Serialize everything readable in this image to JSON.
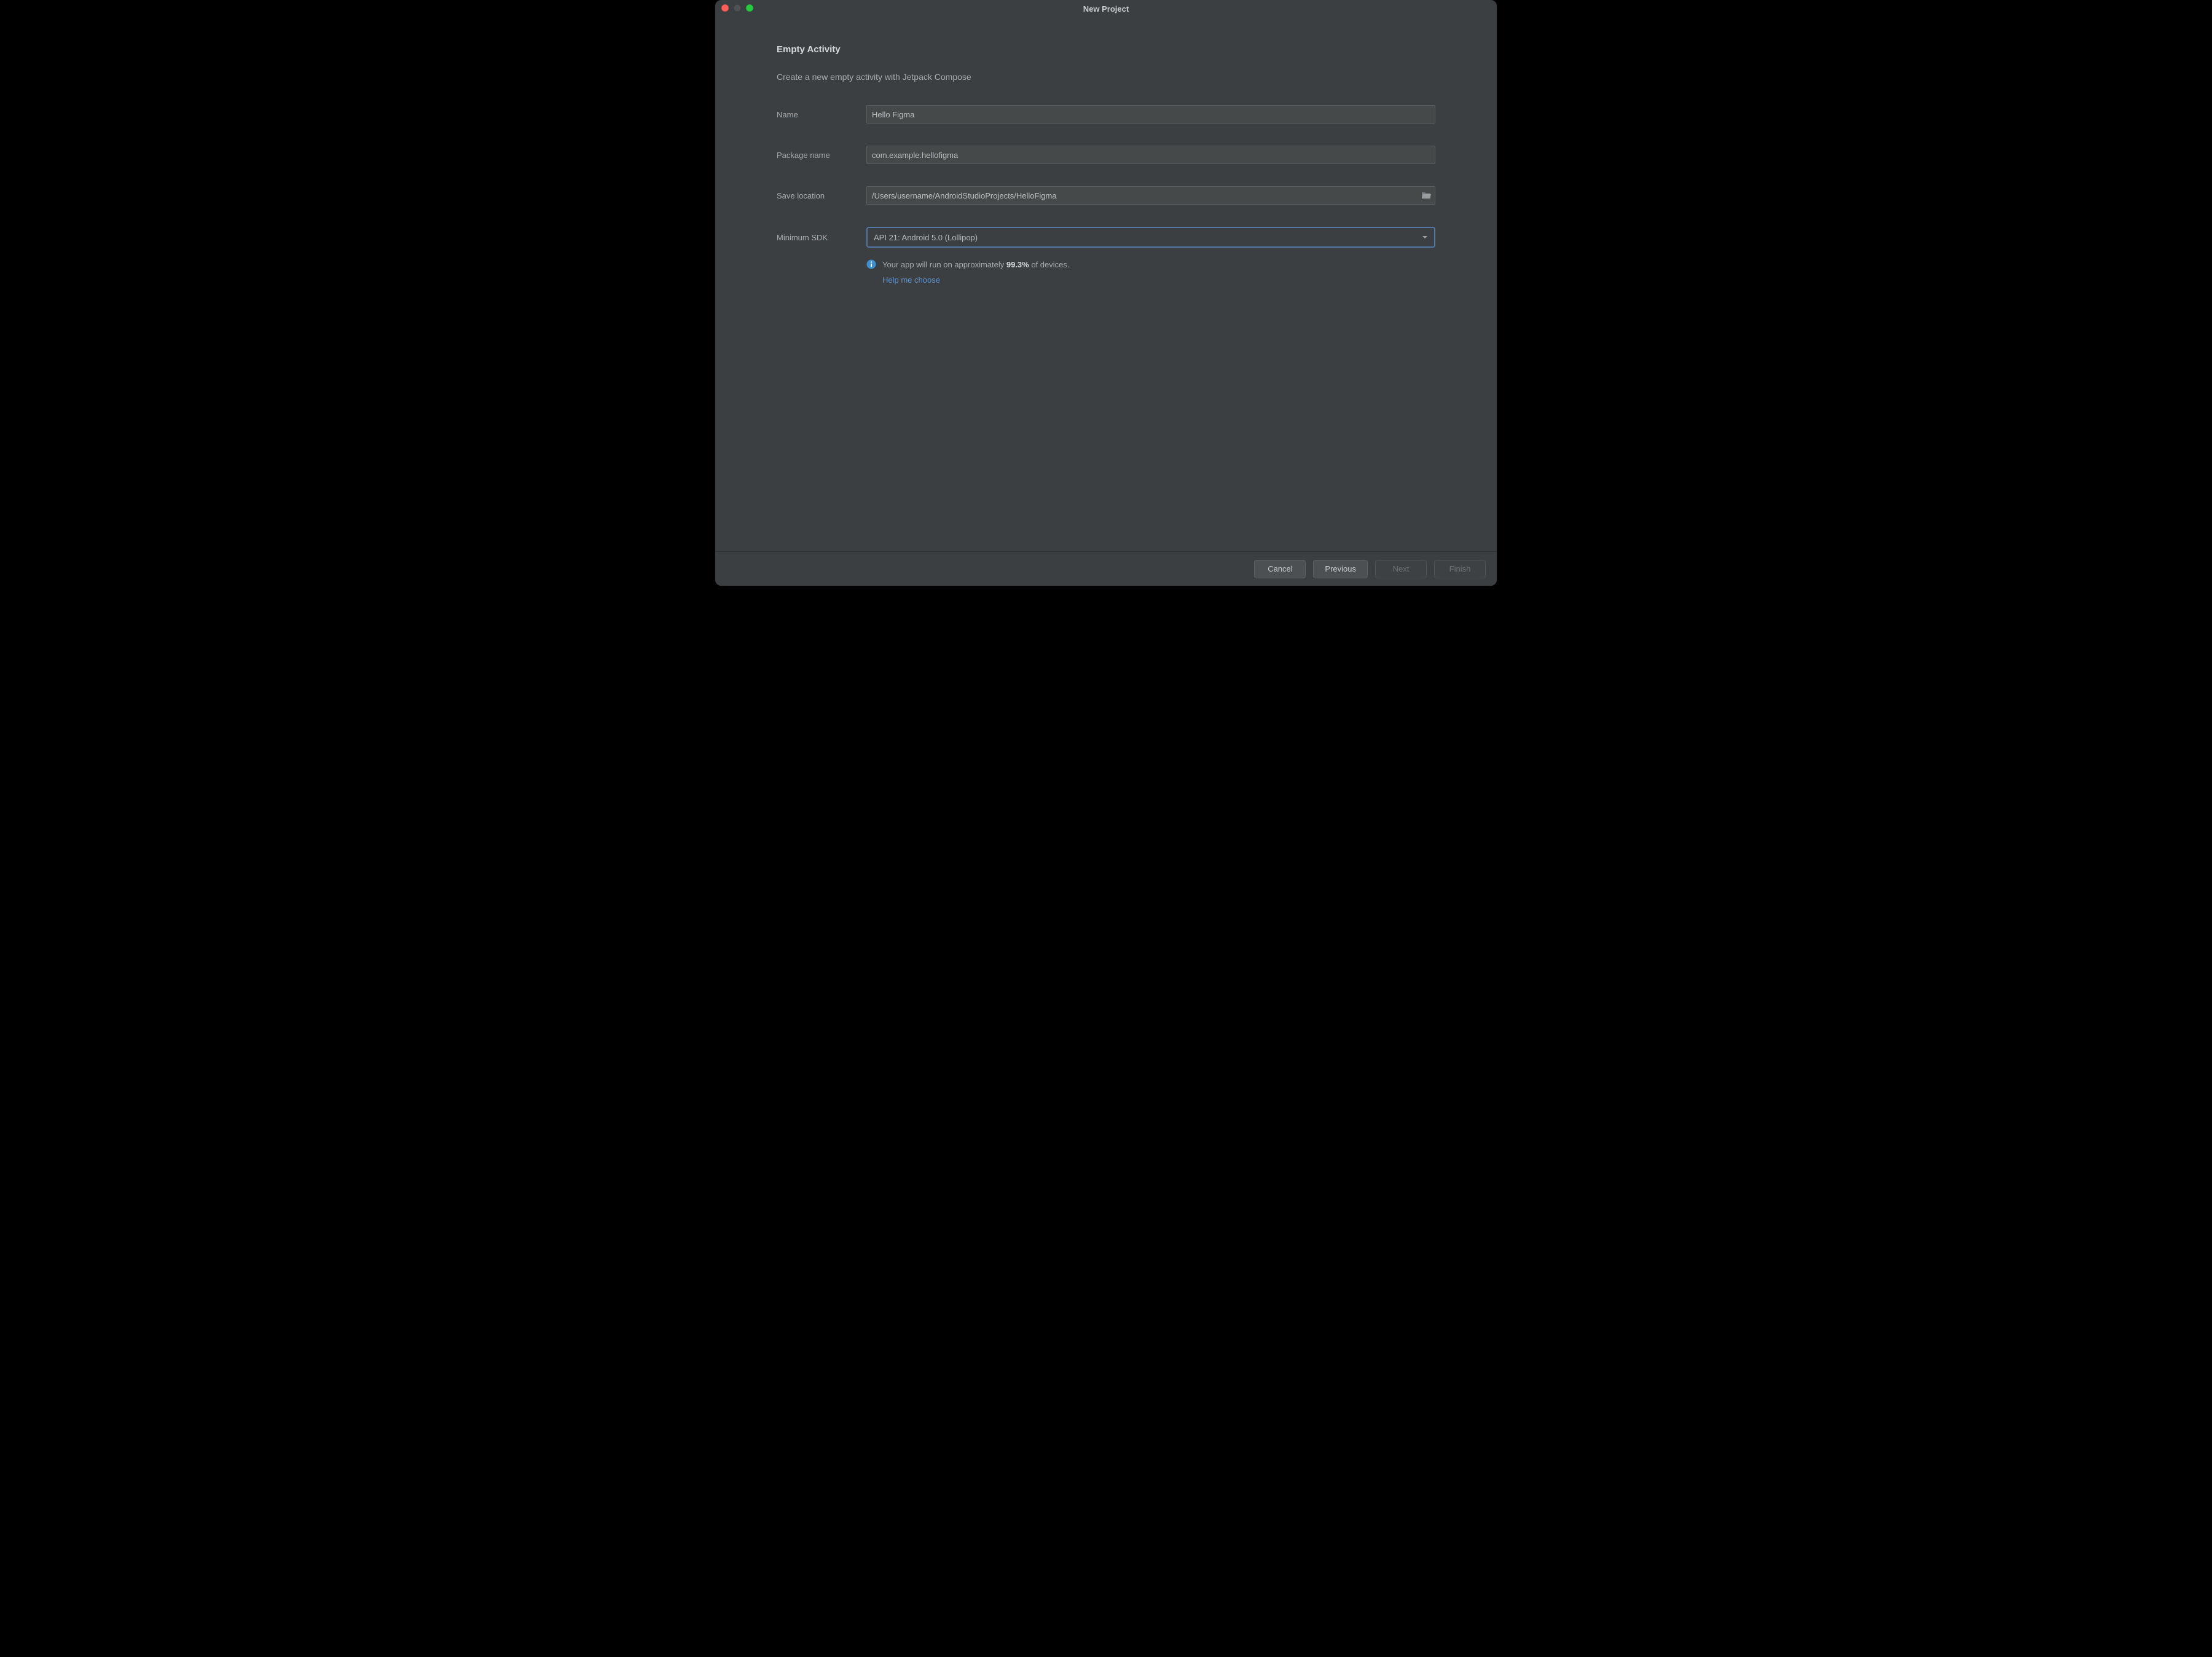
{
  "window": {
    "title": "New Project"
  },
  "headingText": "Empty Activity",
  "subheadingText": "Create a new empty activity with Jetpack Compose",
  "form": {
    "nameLabel": "Name",
    "nameValue": "Hello Figma",
    "packageLabel": "Package name",
    "packageValue": "com.example.hellofigma",
    "locationLabel": "Save location",
    "locationValue": "/Users/username/AndroidStudioProjects/HelloFigma",
    "sdkLabel": "Minimum SDK",
    "sdkValue": "API 21: Android 5.0 (Lollipop)"
  },
  "info": {
    "prefix": "Your app will run on approximately ",
    "pct": "99.3%",
    "suffix": " of devices.",
    "helpLink": "Help me choose"
  },
  "footer": {
    "cancel": "Cancel",
    "previous": "Previous",
    "next": "Next",
    "finish": "Finish"
  }
}
